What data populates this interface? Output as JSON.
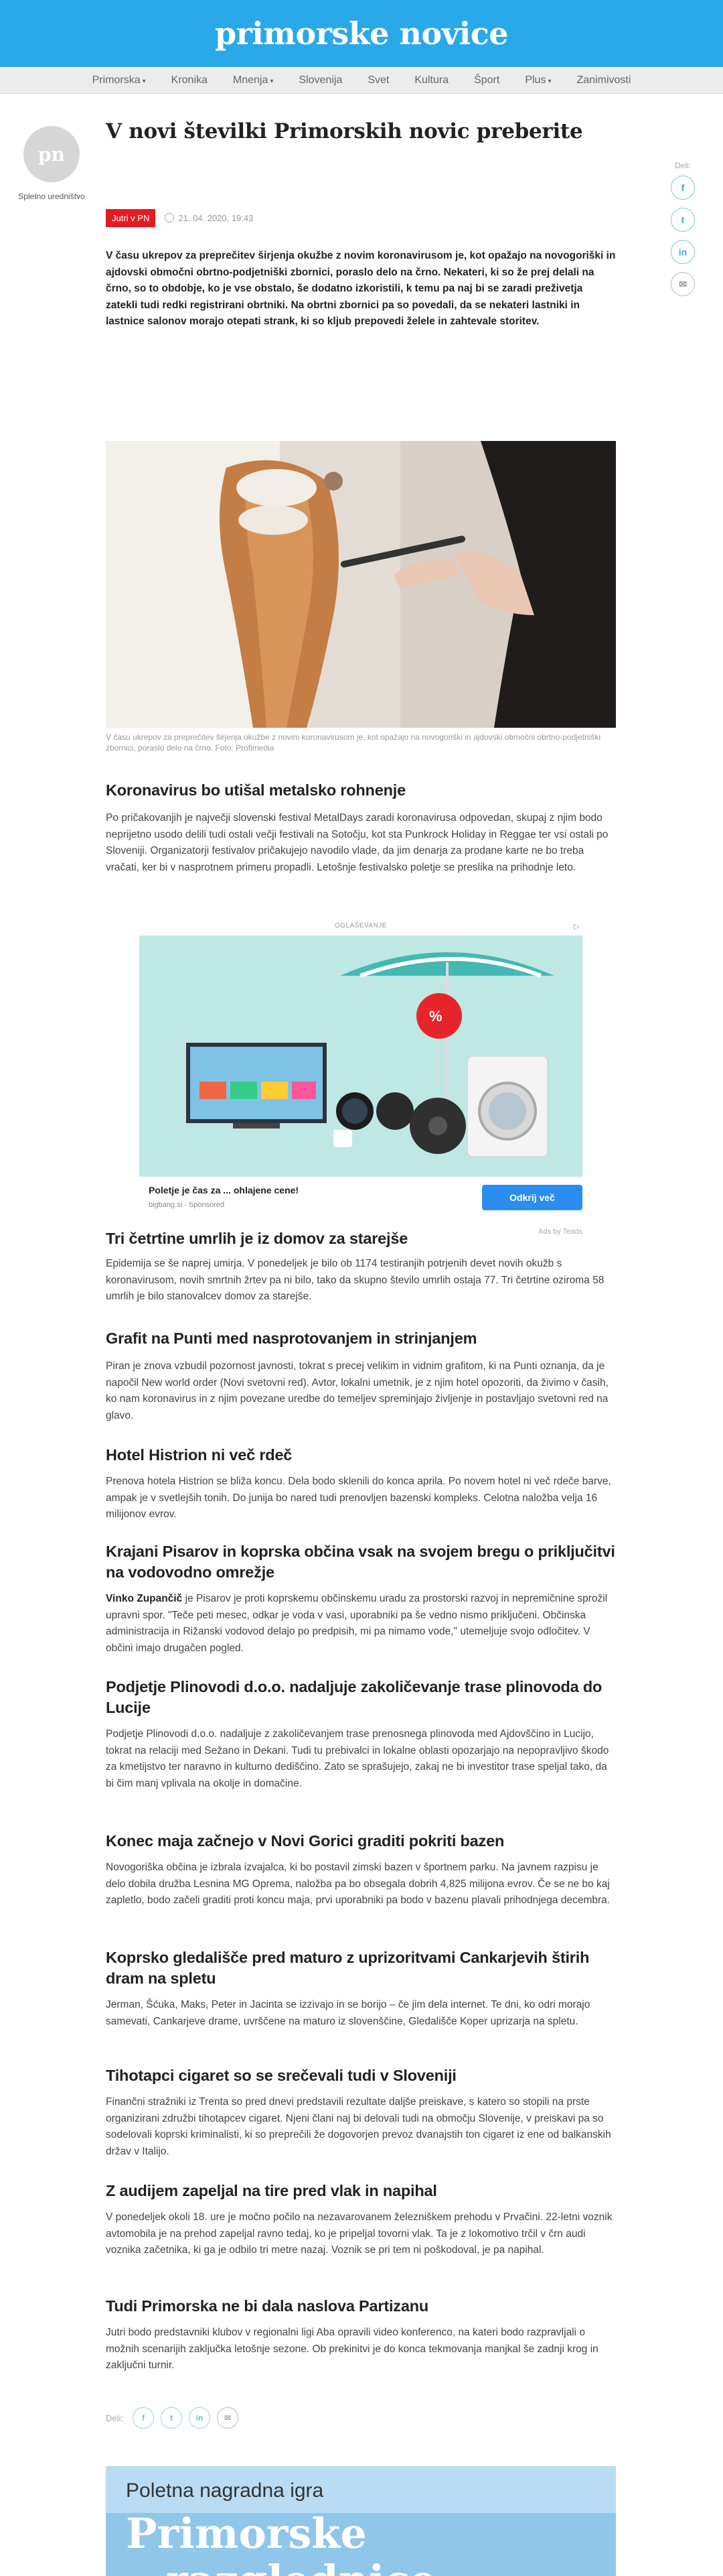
{
  "site": {
    "logo": "primorske novice"
  },
  "nav": [
    {
      "label": "Primorska",
      "dropdown": true
    },
    {
      "label": "Kronika",
      "dropdown": false
    },
    {
      "label": "Mnenja",
      "dropdown": true
    },
    {
      "label": "Slovenija",
      "dropdown": false
    },
    {
      "label": "Svet",
      "dropdown": false
    },
    {
      "label": "Kultura",
      "dropdown": false
    },
    {
      "label": "Šport",
      "dropdown": false
    },
    {
      "label": "Plus",
      "dropdown": true
    },
    {
      "label": "Zanimivosti",
      "dropdown": false
    }
  ],
  "author": {
    "initials": "pn",
    "name": "Spletno uredništvo"
  },
  "share": {
    "label": "Deli:"
  },
  "article": {
    "title": "V novi številki Primorskih novic preberite",
    "tag": "Jutri v PN",
    "date": "21. 04. 2020, 19:43",
    "lead": "V času ukrepov za preprečitev širjenja okužbe z novim koronavirusom je, kot opažajo na novogoriški in ajdovski območni obrtno-podjetniški zbornici, poraslo delo na črno. Nekateri, ki so že prej delali na črno, so to obdobje, ko je vse obstalo, še dodatno izkoristili, k temu pa naj bi se zaradi preživetja zatekli tudi redki registrirani obrtniki. Na obrtni zbornici pa so povedali, da se nekateri lastniki in lastnice salonov morajo otepati strank, ki so kljub prepovedi želele in zahtevale storitev.",
    "caption": "V času ukrepov za preprečitev širjenja okužbe z novim koronavirusom je, kot opažajo na novogoriški in ajdovski območni obrtno-podjetniški zbornici, poraslo delo na črno.  Foto: Profimedia",
    "sections": [
      {
        "heading": "Koronavirus bo utišal metalsko rohnenje",
        "body": "Po pričakovanjih je največji slovenski festival MetalDays zaradi koronavirusa odpovedan, skupaj z njim bodo neprijetno usodo delili tudi ostali večji festivali na Sotočju, kot sta Punkrock Holiday in Reggae ter vsi ostali po Sloveniji. Organizatorji festivalov pričakujejo navodilo vlade, da jim denarja za prodane karte ne bo treba vračati, ker bi v nasprotnem primeru propadli. Letošnje festivalsko poletje se preslika na prihodnje leto."
      },
      {
        "heading": "Tri četrtine umrlih je iz domov za starejše",
        "body": "Epidemija se še naprej umirja. V ponedeljek je bilo ob 1174 testiranjih potrjenih devet novih okužb s koronavirusom, novih smrtnih žrtev pa ni bilo, tako da skupno število umrlih ostaja 77. Tri četrtine oziroma 58 umrlih je bilo stanovalcev domov za starejše."
      },
      {
        "heading": "Grafit na Punti med nasprotovanjem in strinjanjem",
        "body": "Piran je znova vzbudil pozornost javnosti, tokrat s precej velikim in vidnim grafitom, ki na Punti oznanja, da je napočil New world order (Novi svetovni red). Avtor, lokalni umetnik, je z njim hotel opozoriti, da živimo v časih, ko nam koronavirus in z njim povezane uredbe do temeljev spreminjajo življenje in postavljajo svetovni red na glavo."
      },
      {
        "heading": "Hotel Histrion ni več rdeč",
        "body": "Prenova hotela Histrion se bliža koncu. Dela bodo sklenili do konca aprila. Po novem hotel ni več rdeče barve, ampak je v svetlejših tonih. Do junija bo nared tudi prenovljen bazenski kompleks. Celotna naložba velja 16 milijonov evrov."
      },
      {
        "heading": "Krajani Pisarov in koprska občina vsak na svojem bregu o priključitvi na vodovodno omrežje",
        "body_bold": "Vinko Zupančič",
        "body": " je Pisarov je proti koprskemu občinskemu uradu za prostorski razvoj in nepremičnine sprožil upravni spor. \"Teče peti mesec, odkar je voda v vasi, uporabniki pa še vedno nismo priključeni. Občinska administracija in Rižanski vodovod delajo po predpisih, mi pa nimamo vode,\" utemeljuje svojo odločitev. V občini imajo drugačen pogled."
      },
      {
        "heading": "Podjetje Plinovodi d.o.o. nadaljuje zakoličevanje trase plinovoda do Lucije",
        "body": "Podjetje Plinovodi d.o.o. nadaljuje z zakoličevanjem trase prenosnega plinovoda med Ajdovščino in Lucijo, tokrat na relaciji med Sežano in Dekani. Tudi tu prebivalci in lokalne oblasti opozarjajo na nepopravljivo škodo za kmetijstvo ter naravno in kulturno dediščino. Zato se sprašujejo, zakaj ne bi investitor trase speljal tako, da bi čim manj vplivala na okolje in domačine."
      },
      {
        "heading": "Konec maja začnejo v Novi Gorici graditi pokriti bazen",
        "body": "Novogoriška občina je izbrala izvajalca, ki bo postavil zimski bazen v športnem parku. Na javnem razpisu je delo dobila družba Lesnina MG Oprema, naložba pa bo obsegala dobrih 4,825 milijona evrov. Če se ne bo kaj zapletlo, bodo začeli graditi proti koncu maja, prvi uporabniki pa bodo v bazenu plavali prihodnjega decembra."
      },
      {
        "heading": "Koprsko gledališče pred maturo z uprizoritvami Cankarjevih štirih dram na spletu",
        "body": "Jerman, Šćuka, Maks, Peter in Jacinta se izzivajo in se borijo – če jim dela internet. Te dni, ko odri morajo samevati, Cankarjeve drame, uvrščene na maturo iz slovenščine, Gledališče Koper uprizarja na spletu."
      },
      {
        "heading": "Tihotapci cigaret so se srečevali tudi v Sloveniji",
        "body": "Finančni stražniki iz Trenta so pred dnevi predstavili rezultate daljše preiskave, s katero so stopili na prste organizirani združbi tihotapcev cigaret. Njeni člani naj bi delovali tudi na območju Slovenije, v preiskavi pa so sodelovali koprski kriminalisti, ki so preprečili že dogovorjen prevoz dvanajstih ton cigaret iz ene od balkanskih držav v Italijo."
      },
      {
        "heading": "Z audijem zapeljal na tire pred vlak in napihal",
        "body": "V ponedeljek okoli 18. ure je močno počilo na nezavarovanem železniškem prehodu v Prvačini. 22-letni voznik avtomobila je na prehod zapeljal ravno tedaj, ko je pripeljal tovorni vlak. Ta je z lokomotivo trčil v črn audi voznika začetnika, ki ga je odbilo tri metre nazaj. Voznik se pri tem ni poškodoval, je pa napihal."
      },
      {
        "heading": "Tudi Primorska ne bi dala naslova Partizanu",
        "body": "Jutri bodo predstavniki klubov v regionalni ligi Aba opravili video konferenco, na kateri bodo razpravljali o možnih scenarijih zaključka letošnje sezone. Ob prekinitvi je do konca tekmovanja manjkal še zadnji krog in zaključni turnir."
      }
    ]
  },
  "ad": {
    "label": "OGLAŠEVANJE",
    "badge": "%",
    "title": "Poletje je čas za ... ohlajene cene!",
    "sponsor": "bigbang.si · Sponsored",
    "button": "Odkrij več",
    "attribution": "Ads by Teads"
  },
  "promo": {
    "line1": "Poletna nagradna igra",
    "line2": "Primorske",
    "line3": "razglednice"
  },
  "share_bottom": {
    "label": "Deli:"
  },
  "icons": {
    "facebook": "facebook-icon",
    "twitter": "twitter-icon",
    "linkedin": "linkedin-icon",
    "mail": "mail-icon",
    "clock": "clock-icon"
  },
  "colors": {
    "header": "#29a9ea",
    "tag": "#e21c23",
    "ad_button": "#2a8ef0"
  }
}
